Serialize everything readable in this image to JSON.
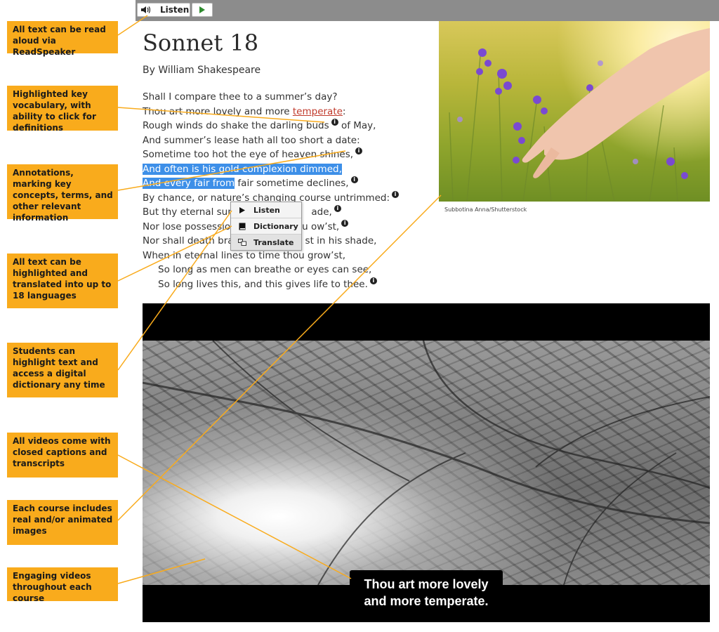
{
  "toolbar": {
    "listen_label": "Listen",
    "speaker_icon": "speaker-icon",
    "play_icon": "play-icon",
    "play_color": "#2e8b2e"
  },
  "callouts": [
    "All text can be read aloud via ReadSpeaker",
    "Highlighted key vocabulary, with ability to click for definitions",
    "Annotations, marking key concepts, terms, and other relevant information",
    "All text can be highlighted and translated into up to 18 languages",
    "Students can highlight text and access a digital dictionary any time",
    "All videos come with closed captions and transcripts",
    "Each course includes real and/or animated images",
    "Engaging videos throughout each course"
  ],
  "poem": {
    "title": "Sonnet 18",
    "byline": "By William Shakespeare",
    "lines": {
      "l1": "Shall I compare thee to a summer’s day?",
      "l2_pre": "Thou art more lovely and more ",
      "l2_vocab": "temperate",
      "l2_post": ":",
      "l3_a": "Rough winds do shake the darling buds",
      "l3_b": " of May,",
      "l4": "And summer’s lease hath all too short a date:",
      "l5": "Sometime too hot the eye of heaven shines,",
      "l6": "And often is his gold complexion dimmed,",
      "l7_hl": "And every fair from",
      "l7_rest": " fair sometime declines,",
      "l8": "By chance, or nature’s changing course untrimmed:",
      "l9_a": "But thy eternal sum",
      "l9_b": "ade,",
      "l10_a": "Nor lose possessio",
      "l10_b": "u ow’st,",
      "l11_a": "Nor shall death bra",
      "l11_b": "st in his shade,",
      "l12": "When in eternal lines to time thou grow’st,",
      "l13": "So long as men can breathe or eyes can see,",
      "l14": "So long lives this, and this gives life to thee."
    },
    "info_glyph": "i"
  },
  "context_menu": {
    "items": [
      "Listen",
      "Dictionary",
      "Translate"
    ]
  },
  "image": {
    "credit": "Subbotina Anna/Shutterstock"
  },
  "video": {
    "caption": "Thou art more lovely\nand more temperate."
  },
  "colors": {
    "callout": "#f9ab1c",
    "highlight": "#3d8fe8",
    "vocab": "#c0392b",
    "toolbar": "#8c8c8c"
  }
}
